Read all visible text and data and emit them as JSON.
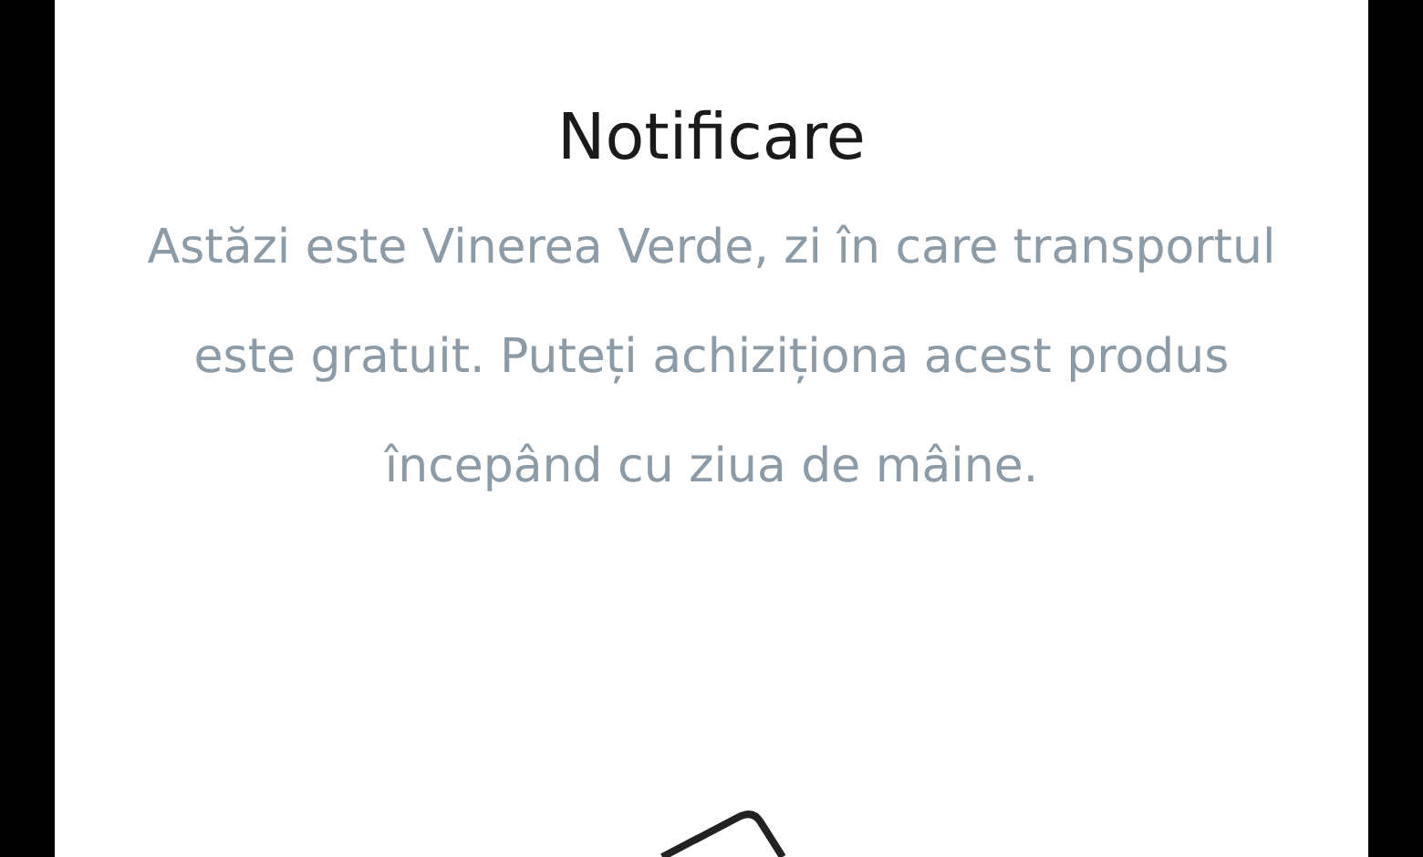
{
  "dialog": {
    "title": "Notificare",
    "message": "Astăzi este Vinerea Verde, zi în care transportul este gratuit. Puteți achiziționa acest produs începând cu ziua de mâine."
  }
}
